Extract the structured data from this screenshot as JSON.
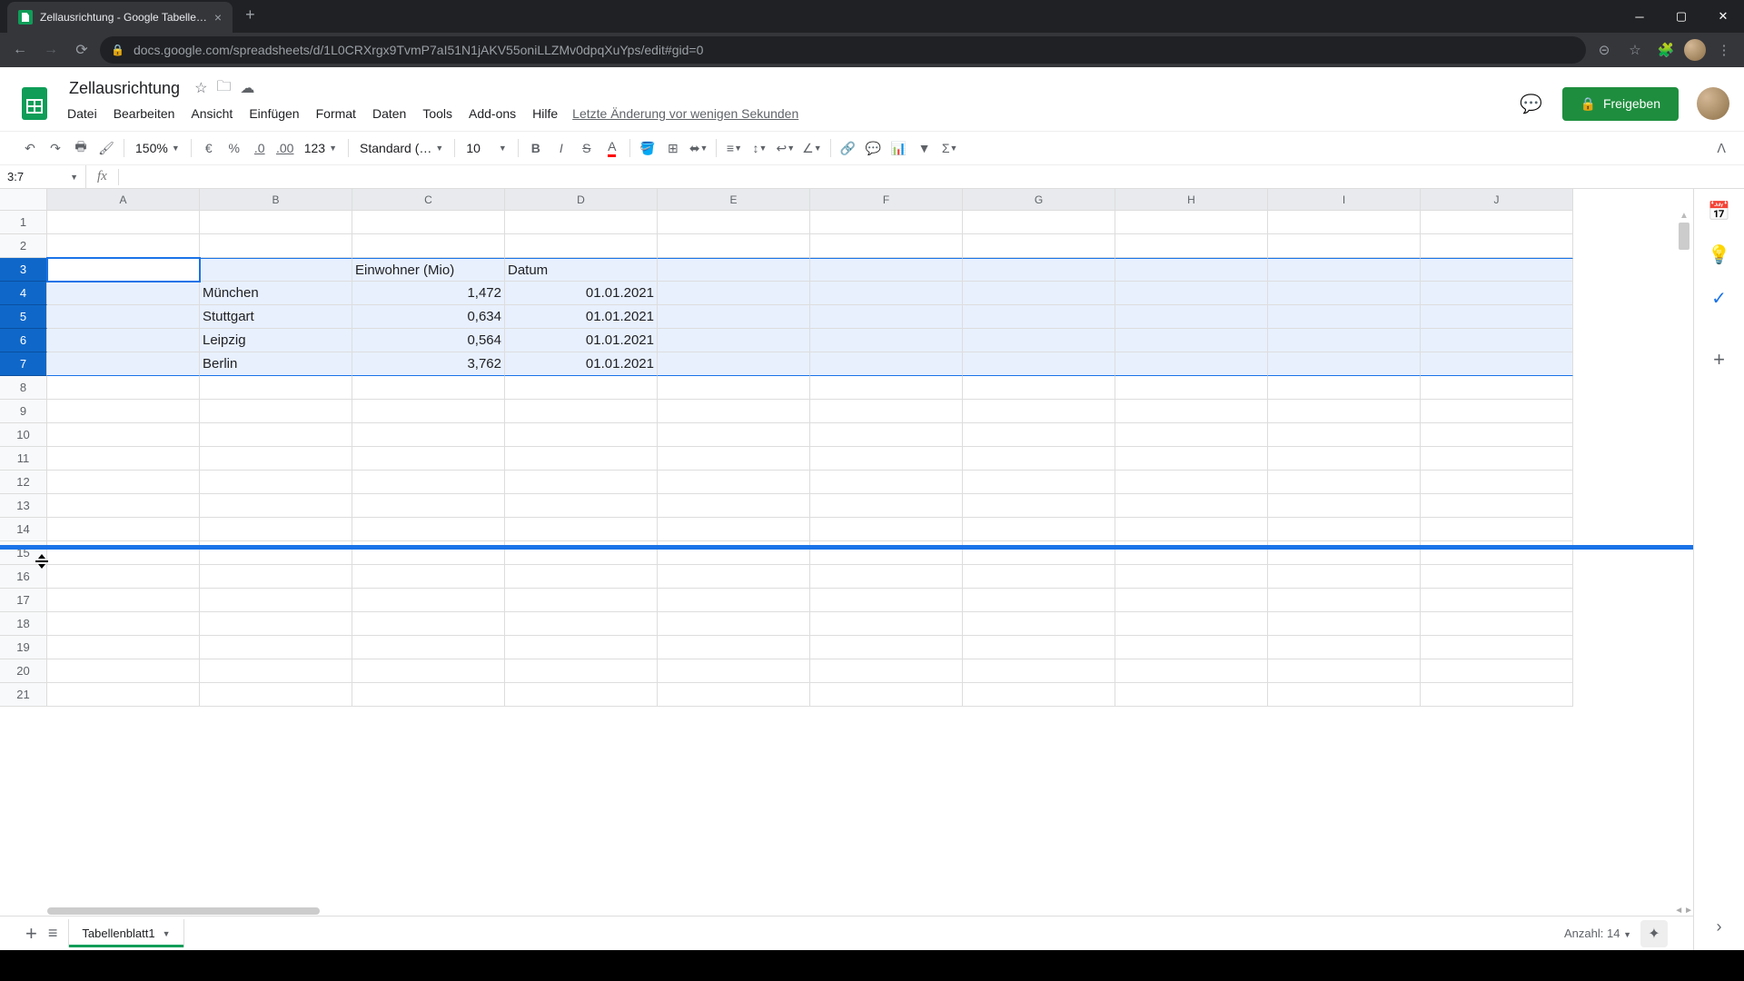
{
  "browser": {
    "tab_title": "Zellausrichtung - Google Tabelle…",
    "url": "docs.google.com/spreadsheets/d/1L0CRXrgx9TvmP7aI51N1jAKV55oniLLZMv0dpqXuYps/edit#gid=0"
  },
  "doc": {
    "title": "Zellausrichtung",
    "last_edit": "Letzte Änderung vor wenigen Sekunden",
    "share_label": "Freigeben"
  },
  "menus": [
    "Datei",
    "Bearbeiten",
    "Ansicht",
    "Einfügen",
    "Format",
    "Daten",
    "Tools",
    "Add-ons",
    "Hilfe"
  ],
  "toolbar": {
    "zoom": "150%",
    "currency": "€",
    "percent": "%",
    "dec_less": ".0",
    "dec_more": ".00",
    "num_format": "123",
    "font": "Standard (…",
    "font_size": "10"
  },
  "namebox": "3:7",
  "columns": [
    "A",
    "B",
    "C",
    "D",
    "E",
    "F",
    "G",
    "H",
    "I",
    "J"
  ],
  "rows": [
    "1",
    "2",
    "3",
    "4",
    "5",
    "6",
    "7",
    "8",
    "9",
    "10",
    "11",
    "12",
    "13",
    "14",
    "15",
    "16",
    "17",
    "18",
    "19",
    "20",
    "21"
  ],
  "data": {
    "C3": "Einwohner (Mio)",
    "D3": "Datum",
    "B4": "München",
    "C4": "1,472",
    "D4": "01.01.2021",
    "B5": "Stuttgart",
    "C5": "0,634",
    "D5": "01.01.2021",
    "B6": "Leipzig",
    "C6": "0,564",
    "D6": "01.01.2021",
    "B7": "Berlin",
    "C7": "3,762",
    "D7": "01.01.2021"
  },
  "sheet_tab": "Tabellenblatt1",
  "status": "Anzahl: 14"
}
